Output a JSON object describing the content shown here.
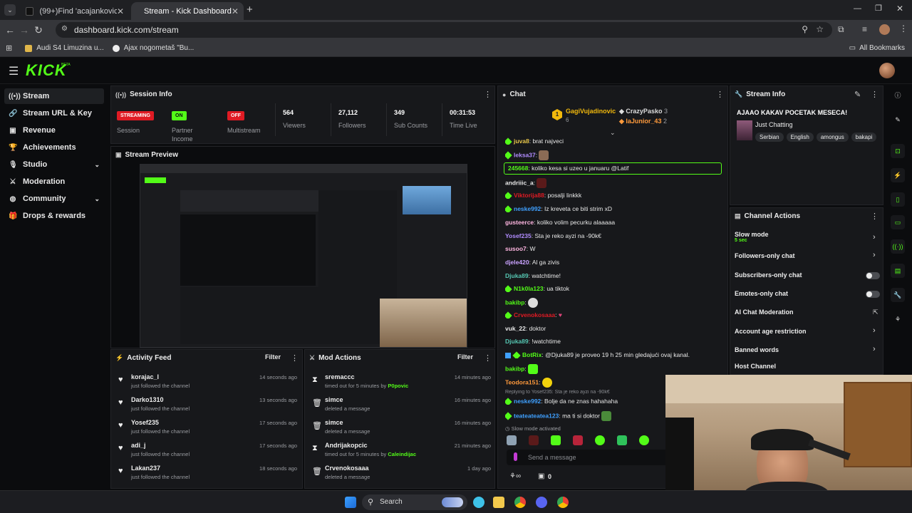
{
  "browser": {
    "tabs": [
      {
        "title": "(99+)Find 'acajankovic' on TikTok"
      },
      {
        "title": "Stream - Kick Dashboard"
      }
    ],
    "url": "dashboard.kick.com/stream",
    "bookmarks": [
      "Audi S4 Limuzina u...",
      "Ajax nogometaš \"Bu..."
    ],
    "all_bookmarks": "All Bookmarks"
  },
  "app": {
    "logo": "KICK",
    "beta": "BETA"
  },
  "sidebar": {
    "items": [
      {
        "label": "Stream",
        "icon": "stream-icon"
      },
      {
        "label": "Stream URL & Key",
        "icon": "link-icon"
      },
      {
        "label": "Revenue",
        "icon": "revenue-icon"
      },
      {
        "label": "Achievements",
        "icon": "trophy-icon"
      },
      {
        "label": "Studio",
        "icon": "mic-icon"
      },
      {
        "label": "Moderation",
        "icon": "sword-icon"
      },
      {
        "label": "Community",
        "icon": "globe-icon"
      },
      {
        "label": "Drops & rewards",
        "icon": "gift-icon"
      }
    ]
  },
  "session": {
    "title": "Session Info",
    "stats": [
      {
        "badge": "STREAMING",
        "label": "Session",
        "color": "#e01b24"
      },
      {
        "badge": "ON",
        "label": "Partner Income",
        "color": "#53fc18"
      },
      {
        "badge": "OFF",
        "label": "Multistream",
        "color": "#e01b24"
      },
      {
        "value": "564",
        "label": "Viewers"
      },
      {
        "value": "27,112",
        "label": "Followers"
      },
      {
        "value": "349",
        "label": "Sub Counts"
      },
      {
        "value": "00:31:53",
        "label": "Time Live"
      }
    ]
  },
  "preview": {
    "title": "Stream Preview"
  },
  "activity": {
    "title": "Activity Feed",
    "filter": "Filter",
    "rows": [
      {
        "name": "korajac_l",
        "desc": "just followed the channel",
        "time": "14 seconds ago"
      },
      {
        "name": "Darko1310",
        "desc": "just followed the channel",
        "time": "13 seconds ago"
      },
      {
        "name": "Yosef235",
        "desc": "just followed the channel",
        "time": "17 seconds ago"
      },
      {
        "name": "adi_j",
        "desc": "just followed the channel",
        "time": "17 seconds ago"
      },
      {
        "name": "Lakan237",
        "desc": "just followed the channel",
        "time": "18 seconds ago"
      }
    ]
  },
  "modactions": {
    "title": "Mod Actions",
    "filter": "Filter",
    "rows": [
      {
        "name": "sremaccc",
        "desc": "timed out for 5 minutes by",
        "by": "P0povic",
        "time": "14 minutes ago",
        "icon": "hourglass-icon"
      },
      {
        "name": "simce",
        "desc": "deleted a message",
        "by": "",
        "time": "16 minutes ago",
        "icon": "trash-icon"
      },
      {
        "name": "simce",
        "desc": "deleted a message",
        "by": "",
        "time": "16 minutes ago",
        "icon": "trash-icon"
      },
      {
        "name": "Andrijakopcic",
        "desc": "timed out for 5 minutes by",
        "by": "Caleindijac",
        "time": "21 minutes ago",
        "icon": "hourglass-icon"
      },
      {
        "name": "Crvenokosaaa",
        "desc": "deleted a message",
        "by": "",
        "time": "1 day ago",
        "icon": "trash-icon"
      }
    ]
  },
  "chat": {
    "title": "Chat",
    "top": [
      {
        "rank": "1",
        "name": "GagiVujadinovic",
        "count": "6"
      },
      {
        "name": "CrazyPasko",
        "count": "3"
      },
      {
        "name": "laJunior_43",
        "count": "2"
      }
    ],
    "messages": [
      {
        "user": "juva8",
        "text": "brat najveci",
        "color": "#e8c64a"
      },
      {
        "user": "leksa37",
        "text": "",
        "color": "#b18cff"
      },
      {
        "user": "245668",
        "text": "koliko kesa si uzeo u januaru @Latif",
        "color": "#53fc18"
      },
      {
        "user": "andriiic_a",
        "text": "",
        "color": "#e8e8e8"
      },
      {
        "user": "Viktorija88",
        "text": "posalji linkkk",
        "color": "#e01b24"
      },
      {
        "user": "neske992",
        "text": "Iz kreveta ce biti strim xD",
        "color": "#3fa0ff"
      },
      {
        "user": "gusteerce",
        "text": "koliko volim pecurku alaaaaa",
        "color": "#ffb6e1"
      },
      {
        "user": "Yosef235",
        "text": "Sta je reko ayzi na -90k€",
        "color": "#b18cff"
      },
      {
        "user": "susoo7",
        "text": "W",
        "color": "#ffb6e1"
      },
      {
        "user": "djele420",
        "text": "Al ga zivis",
        "color": "#c9a2ff"
      },
      {
        "user": "Djuka89",
        "text": "watchtime!",
        "color": "#56c7b3"
      },
      {
        "user": "N1k0la123",
        "text": "ua tiktok",
        "color": "#53fc18"
      },
      {
        "user": "bakibp",
        "text": "",
        "color": "#53fc18"
      },
      {
        "user": "Crvenokosaaa",
        "text": "",
        "color": "#e01b24"
      },
      {
        "user": "vuk_22",
        "text": "doktor",
        "color": "#e8e8e8"
      },
      {
        "user": "Djuka89",
        "text": "!watchtime",
        "color": "#56c7b3"
      },
      {
        "user": "BotRix",
        "text": "@Djuka89 je proveo 19 h 25 min gledajući ovaj kanal.",
        "color": "#53fc18"
      },
      {
        "user": "bakibp",
        "text": "",
        "color": "#53fc18"
      },
      {
        "user": "Teodora151",
        "text": "",
        "color": "#ff9a3c"
      },
      {
        "user": "neske992",
        "text": "Bolje da ne znas hahahaha",
        "color": "#3fa0ff",
        "reply": "Replying to Yosef235: Sta je reko ayzi na -90k€"
      },
      {
        "user": "teateateatea123",
        "text": "ma ti si doktor",
        "color": "#3fa0ff"
      }
    ],
    "slow_mode": "Slow mode activated",
    "placeholder": "Send a message",
    "footer_count": "0"
  },
  "streaminfo": {
    "title": "Stream Info",
    "stream_title": "AJAAO KAKAV POCETAK MESECA!",
    "category": "Just Chatting",
    "tags": [
      "Serbian",
      "English",
      "amongus",
      "bakapi"
    ]
  },
  "channelactions": {
    "title": "Channel Actions",
    "items": [
      {
        "label": "Slow mode",
        "sub": "5 sec",
        "control": "arrow"
      },
      {
        "label": "Followers-only chat",
        "sub": "",
        "control": "arrow"
      },
      {
        "label": "Subscribers-only chat",
        "sub": "",
        "control": "toggle"
      },
      {
        "label": "Emotes-only chat",
        "sub": "",
        "control": "toggle"
      },
      {
        "label": "AI Chat Moderation",
        "sub": "",
        "control": "external"
      },
      {
        "label": "Account age restriction",
        "sub": "",
        "control": "arrow"
      },
      {
        "label": "Banned words",
        "sub": "",
        "control": "arrow"
      },
      {
        "label": "Host Channel",
        "sub": "",
        "control": "none"
      }
    ]
  },
  "taskbar": {
    "search": "Search"
  }
}
